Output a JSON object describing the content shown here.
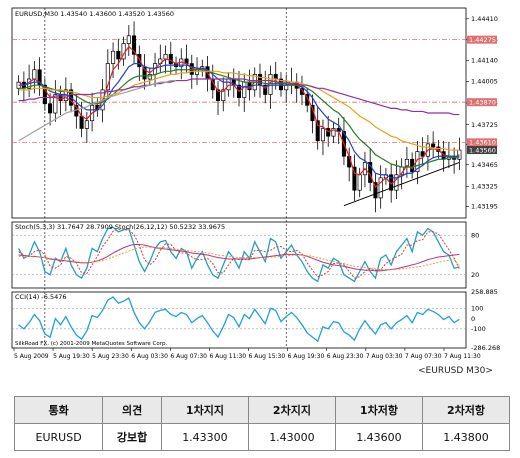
{
  "chart_data": {
    "type": "line",
    "header": "EURUSD,M30  1.43540 1.43600 1.43520 1.43560",
    "price_axis_ticks": [
      "1.44410",
      "1.44275",
      "1.44140",
      "1.44005",
      "1.43865",
      "1.43725",
      "1.43595",
      "1.43465",
      "1.43325",
      "1.43195"
    ],
    "price_highlight_labels": [
      {
        "value": "1.44275",
        "color": "#e07070"
      },
      {
        "value": "1.43870",
        "color": "#e07070"
      },
      {
        "value": "1.43610",
        "color": "#e07070"
      },
      {
        "value": "1.43560",
        "color": "#404040"
      }
    ],
    "ylim": [
      1.4312,
      1.4448
    ],
    "horizontal_levels": [
      1.44275,
      1.4387,
      1.4361
    ],
    "time_labels": [
      "5 Aug 2009",
      "5 Aug 19:30",
      "5 Aug 23:30",
      "6 Aug 03:30",
      "6 Aug 07:30",
      "6 Aug 11:30",
      "6 Aug 15:30",
      "6 Aug 19:30",
      "6 Aug 23:30",
      "7 Aug 03:30",
      "7 Aug 07:30",
      "7 Aug 11:30"
    ],
    "price_series": {
      "name": "EURUSD M30",
      "close": [
        1.44,
        1.4396,
        1.4402,
        1.4408,
        1.4398,
        1.4386,
        1.438,
        1.4392,
        1.4388,
        1.4395,
        1.4385,
        1.4378,
        1.437,
        1.4375,
        1.4385,
        1.4382,
        1.4395,
        1.4412,
        1.442,
        1.4415,
        1.4425,
        1.443,
        1.4418,
        1.441,
        1.4402,
        1.4405,
        1.4412,
        1.4415,
        1.4418,
        1.4412,
        1.441,
        1.4415,
        1.4412,
        1.4405,
        1.4408,
        1.441,
        1.4402,
        1.4395,
        1.4388,
        1.4395,
        1.4402,
        1.4398,
        1.439,
        1.44,
        1.4395,
        1.4405,
        1.4398,
        1.4392,
        1.4405,
        1.4402,
        1.4395,
        1.4398,
        1.44,
        1.4396,
        1.4392,
        1.4385,
        1.4375,
        1.4362,
        1.437,
        1.4365,
        1.437,
        1.4368,
        1.4352,
        1.4345,
        1.433,
        1.434,
        1.4348,
        1.4335,
        1.4325,
        1.4338,
        1.434,
        1.433,
        1.434,
        1.4345,
        1.435,
        1.4342,
        1.4355,
        1.4352,
        1.436,
        1.4358,
        1.4355,
        1.435,
        1.4352,
        1.435,
        1.4356
      ]
    },
    "overlays": [
      {
        "color": "#dd2020",
        "values": [
          1.44,
          1.4398,
          1.44,
          1.4402,
          1.44,
          1.4395,
          1.439,
          1.439,
          1.4389,
          1.439,
          1.4388,
          1.4384,
          1.4378,
          1.4376,
          1.438,
          1.4382,
          1.4388,
          1.4398,
          1.4408,
          1.4412,
          1.4418,
          1.4423,
          1.442,
          1.4415,
          1.4408,
          1.4406,
          1.4409,
          1.4412,
          1.4415,
          1.4414,
          1.4412,
          1.4413,
          1.4412,
          1.4409,
          1.4408,
          1.4409,
          1.4406,
          1.44,
          1.4394,
          1.4394,
          1.4398,
          1.4398,
          1.4394,
          1.4397,
          1.4396,
          1.44,
          1.4399,
          1.4396,
          1.44,
          1.4401,
          1.4398,
          1.4398,
          1.4399,
          1.4398,
          1.4395,
          1.439,
          1.4383,
          1.4372,
          1.4371,
          1.4368,
          1.4369,
          1.4368,
          1.436,
          1.4352,
          1.4341,
          1.434,
          1.4344,
          1.434,
          1.4332,
          1.4335,
          1.4338,
          1.4334,
          1.4337,
          1.4341,
          1.4346,
          1.4344,
          1.435,
          1.4351,
          1.4356,
          1.4357,
          1.4356,
          1.4353,
          1.4352,
          1.4351,
          1.4353
        ]
      },
      {
        "color": "#2040d0",
        "values": [
          1.4398,
          1.4398,
          1.4399,
          1.44,
          1.44,
          1.4397,
          1.4394,
          1.4393,
          1.4392,
          1.4392,
          1.439,
          1.4387,
          1.4384,
          1.4382,
          1.4382,
          1.4382,
          1.4385,
          1.439,
          1.4396,
          1.44,
          1.4405,
          1.441,
          1.4412,
          1.4412,
          1.441,
          1.4409,
          1.4409,
          1.441,
          1.4411,
          1.4411,
          1.4411,
          1.4411,
          1.4411,
          1.441,
          1.4409,
          1.4409,
          1.4408,
          1.4405,
          1.4402,
          1.44,
          1.44,
          1.4399,
          1.4397,
          1.4397,
          1.4397,
          1.4398,
          1.4398,
          1.4397,
          1.4398,
          1.4398,
          1.4398,
          1.4398,
          1.4398,
          1.4398,
          1.4397,
          1.4394,
          1.439,
          1.4384,
          1.438,
          1.4376,
          1.4374,
          1.4372,
          1.4367,
          1.4362,
          1.4355,
          1.4351,
          1.4349,
          1.4346,
          1.4341,
          1.434,
          1.434,
          1.4338,
          1.4338,
          1.4339,
          1.4341,
          1.4341,
          1.4344,
          1.4346,
          1.4349,
          1.4351,
          1.4352,
          1.4352,
          1.4352,
          1.4352,
          1.4352
        ]
      },
      {
        "color": "#208020",
        "values": [
          1.4396,
          1.4396,
          1.4397,
          1.4398,
          1.4398,
          1.4397,
          1.4396,
          1.4395,
          1.4394,
          1.4394,
          1.4393,
          1.4391,
          1.4389,
          1.4387,
          1.4386,
          1.4386,
          1.4387,
          1.4389,
          1.4392,
          1.4395,
          1.4398,
          1.4401,
          1.4403,
          1.4404,
          1.4404,
          1.4404,
          1.4405,
          1.4406,
          1.4407,
          1.4407,
          1.4408,
          1.4408,
          1.4408,
          1.4408,
          1.4408,
          1.4408,
          1.4407,
          1.4406,
          1.4405,
          1.4404,
          1.4403,
          1.4402,
          1.4401,
          1.44,
          1.44,
          1.44,
          1.44,
          1.4399,
          1.4399,
          1.4399,
          1.4399,
          1.4399,
          1.4398,
          1.4398,
          1.4398,
          1.4396,
          1.4394,
          1.4391,
          1.4388,
          1.4385,
          1.4382,
          1.438,
          1.4376,
          1.4372,
          1.4367,
          1.4363,
          1.436,
          1.4357,
          1.4353,
          1.4351,
          1.4349,
          1.4347,
          1.4346,
          1.4345,
          1.4345,
          1.4345,
          1.4346,
          1.4347,
          1.4348,
          1.4349,
          1.435,
          1.435,
          1.4351,
          1.4351,
          1.4351
        ]
      },
      {
        "color": "#e8a020",
        "values": [
          1.4395,
          1.4395,
          1.4395,
          1.4396,
          1.4396,
          1.4396,
          1.4395,
          1.4395,
          1.4395,
          1.4394,
          1.4394,
          1.4393,
          1.4392,
          1.4391,
          1.439,
          1.439,
          1.439,
          1.4391,
          1.4392,
          1.4393,
          1.4395,
          1.4396,
          1.4398,
          1.4399,
          1.44,
          1.4401,
          1.4402,
          1.4403,
          1.4404,
          1.4405,
          1.4405,
          1.4406,
          1.4406,
          1.4407,
          1.4407,
          1.4407,
          1.4407,
          1.4407,
          1.4407,
          1.4406,
          1.4406,
          1.4406,
          1.4405,
          1.4405,
          1.4404,
          1.4404,
          1.4403,
          1.4403,
          1.4402,
          1.4402,
          1.4401,
          1.4401,
          1.44,
          1.44,
          1.4399,
          1.4398,
          1.4397,
          1.4396,
          1.4394,
          1.4392,
          1.439,
          1.4388,
          1.4386,
          1.4384,
          1.4381,
          1.4378,
          1.4376,
          1.4374,
          1.4371,
          1.4369,
          1.4367,
          1.4365,
          1.4364,
          1.4362,
          1.4361,
          1.436,
          1.4359,
          1.4358,
          1.4358,
          1.4357,
          1.4357,
          1.4357,
          1.4356,
          1.4356,
          1.4356
        ]
      },
      {
        "color": "#9030a0",
        "values": [
          1.4388,
          1.4388,
          1.4389,
          1.4389,
          1.439,
          1.439,
          1.439,
          1.4391,
          1.4391,
          1.4391,
          1.4392,
          1.4392,
          1.4392,
          1.4392,
          1.4392,
          1.4393,
          1.4393,
          1.4394,
          1.4394,
          1.4395,
          1.4395,
          1.4396,
          1.4397,
          1.4397,
          1.4398,
          1.4398,
          1.4399,
          1.4399,
          1.44,
          1.44,
          1.4401,
          1.4401,
          1.4401,
          1.4402,
          1.4402,
          1.4402,
          1.4402,
          1.4402,
          1.4402,
          1.4402,
          1.4402,
          1.4402,
          1.4402,
          1.4402,
          1.4401,
          1.4401,
          1.4401,
          1.4401,
          1.4401,
          1.44,
          1.44,
          1.44,
          1.4399,
          1.4399,
          1.4398,
          1.4398,
          1.4397,
          1.4396,
          1.4396,
          1.4395,
          1.4394,
          1.4393,
          1.4392,
          1.4391,
          1.439,
          1.4389,
          1.4388,
          1.4387,
          1.4386,
          1.4385,
          1.4384,
          1.4383,
          1.4383,
          1.4382,
          1.4382,
          1.4381,
          1.4381,
          1.4381,
          1.438,
          1.438,
          1.438,
          1.438,
          1.438,
          1.4379,
          1.4379
        ]
      },
      {
        "color": "#a0a0a0",
        "values": [
          1.4362,
          1.4364,
          1.4366,
          1.4368,
          1.437,
          1.4372,
          1.4374,
          1.4376,
          1.4378,
          1.438,
          1.4381,
          1.4382,
          1.4383,
          1.4384,
          1.4386,
          1.4387,
          1.4388,
          1.439,
          1.4391,
          1.4392,
          1.4393,
          1.4394,
          1.4395,
          1.4396,
          1.4397,
          1.4398,
          1.4399,
          1.44,
          1.44,
          1.4401,
          1.4401
        ]
      }
    ],
    "trendline": {
      "color": "#000000",
      "from": [
        62,
        1.432
      ],
      "to": [
        84,
        1.4348
      ]
    },
    "stochastic": {
      "label": "Stoch(5,3,3) 31.7647 28.7909  Stoch(26,12,12) 50.5232 33.9675",
      "axis_ticks": [
        "80",
        "20"
      ],
      "ylim": [
        0,
        100
      ],
      "levels": [
        80,
        20
      ],
      "series": [
        {
          "color": "#20a0c0",
          "values": [
            60,
            45,
            50,
            70,
            55,
            25,
            20,
            45,
            40,
            60,
            35,
            20,
            15,
            30,
            60,
            55,
            75,
            90,
            92,
            85,
            88,
            90,
            65,
            40,
            25,
            40,
            60,
            70,
            72,
            55,
            45,
            60,
            55,
            30,
            45,
            55,
            35,
            20,
            15,
            35,
            55,
            45,
            30,
            55,
            45,
            70,
            55,
            40,
            75,
            70,
            45,
            55,
            65,
            50,
            40,
            25,
            15,
            10,
            35,
            30,
            45,
            40,
            20,
            15,
            10,
            25,
            40,
            25,
            15,
            45,
            50,
            35,
            55,
            65,
            75,
            55,
            85,
            80,
            90,
            85,
            70,
            55,
            50,
            30,
            32
          ]
        },
        {
          "color": "#d04040",
          "values": [
            55,
            50,
            48,
            55,
            58,
            50,
            33,
            30,
            35,
            48,
            45,
            38,
            23,
            22,
            35,
            48,
            63,
            73,
            86,
            89,
            88,
            88,
            81,
            65,
            43,
            35,
            42,
            57,
            67,
            66,
            57,
            53,
            53,
            47,
            43,
            43,
            45,
            37,
            23,
            23,
            35,
            45,
            43,
            43,
            43,
            57,
            57,
            55,
            57,
            62,
            63,
            57,
            55,
            57,
            52,
            38,
            27,
            17,
            20,
            25,
            37,
            38,
            35,
            25,
            15,
            17,
            25,
            30,
            27,
            28,
            37,
            43,
            47,
            51,
            65,
            65,
            72,
            73,
            85,
            85,
            82,
            70,
            58,
            45,
            29
          ]
        },
        {
          "color": "#c03080",
          "values": [
            50,
            49,
            48,
            48,
            47,
            46,
            44,
            43,
            42,
            41,
            40,
            39,
            38,
            38,
            39,
            41,
            44,
            48,
            53,
            57,
            61,
            64,
            66,
            66,
            65,
            63,
            61,
            60,
            59,
            58,
            57,
            56,
            55,
            53,
            52,
            51,
            50,
            48,
            46,
            45,
            44,
            44,
            44,
            44,
            44,
            45,
            46,
            47,
            48,
            49,
            50,
            51,
            51,
            51,
            50,
            48,
            45,
            42,
            39,
            37,
            35,
            34,
            33,
            31,
            29,
            28,
            27,
            27,
            26,
            26,
            27,
            28,
            29,
            31,
            33,
            35,
            37,
            40,
            43,
            45,
            47,
            48,
            49,
            50,
            51
          ]
        },
        {
          "color": "#e0a040",
          "values": [
            48,
            48,
            48,
            47,
            47,
            46,
            45,
            44,
            43,
            42,
            41,
            40,
            39,
            39,
            39,
            40,
            42,
            44,
            47,
            50,
            53,
            56,
            59,
            61,
            62,
            62,
            62,
            61,
            61,
            60,
            59,
            58,
            57,
            56,
            55,
            54,
            53,
            52,
            50,
            49,
            48,
            47,
            46,
            46,
            46,
            46,
            46,
            46,
            47,
            47,
            48,
            49,
            49,
            50,
            50,
            49,
            48,
            46,
            44,
            42,
            40,
            38,
            37,
            35,
            33,
            32,
            31,
            30,
            29,
            28,
            28,
            28,
            28,
            29,
            30,
            31,
            32,
            33,
            35,
            37,
            39,
            41,
            42,
            43,
            34
          ]
        }
      ]
    },
    "cci": {
      "label": "CCI(14) -6.5476",
      "axis_ticks": [
        "258.885",
        "100",
        "0",
        "-100",
        "-286.268"
      ],
      "ylim": [
        -286.268,
        258.885
      ],
      "levels": [
        100,
        -100
      ],
      "values": [
        -60,
        -100,
        -40,
        40,
        -20,
        -150,
        -180,
        0,
        -60,
        20,
        -80,
        -160,
        -200,
        -120,
        30,
        10,
        80,
        180,
        210,
        150,
        170,
        200,
        60,
        -40,
        -100,
        -30,
        60,
        80,
        90,
        40,
        20,
        60,
        40,
        -40,
        0,
        30,
        -40,
        -120,
        -180,
        -80,
        40,
        10,
        -80,
        40,
        0,
        90,
        20,
        -50,
        100,
        80,
        -30,
        20,
        60,
        10,
        -60,
        -140,
        -180,
        -220,
        -80,
        -100,
        -30,
        -40,
        -130,
        -160,
        -210,
        -100,
        -20,
        -90,
        -150,
        -60,
        -40,
        -100,
        -40,
        -10,
        30,
        -40,
        60,
        40,
        90,
        70,
        40,
        -10,
        20,
        -40,
        -6.5
      ]
    },
    "watermark_text": "SilkRoad FX, (c) 2001-2009 MetaQuotes Software Corp.",
    "caption": "<EURUSD M30>"
  },
  "table": {
    "headers": [
      "통화",
      "의견",
      "1차지지",
      "2차지지",
      "1차저항",
      "2차저항"
    ],
    "rows": [
      [
        "EURUSD",
        "강보합",
        "1.43300",
        "1.43000",
        "1.43600",
        "1.43800"
      ]
    ]
  },
  "colors": {
    "up_candle": "#ffffff",
    "down_candle": "#000000",
    "level_line": "#e07070",
    "vertical_dash": "#000000"
  }
}
